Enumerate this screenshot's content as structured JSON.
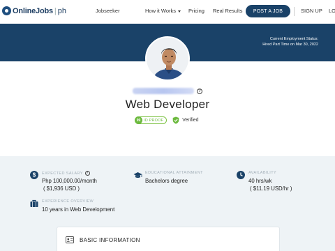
{
  "nav": {
    "logo_main": "OnlineJobs",
    "logo_sep": "|",
    "logo_suffix": "ph",
    "links": {
      "jobseeker": "Jobseeker",
      "how_it_works": "How it Works",
      "pricing": "Pricing",
      "real_results": "Real Results"
    },
    "post_job": "POST A JOB",
    "sign_up": "SIGN UP",
    "login_partial": "LO"
  },
  "banner": {
    "status_label": "Current Employment Status:",
    "status_value": "Hired Part Time on Mar 30, 2022"
  },
  "profile": {
    "title": "Web Developer",
    "id_score": "99",
    "id_label": "ID PROOF",
    "verified_label": "Verified"
  },
  "info": {
    "expected_salary": {
      "label": "EXPECTED SALARY",
      "value": "Php 100,000.00/month",
      "sub": "( $1,936 USD )"
    },
    "education": {
      "label": "EDUCATIONAL ATTAINMENT",
      "value": "Bachelors degree"
    },
    "availability": {
      "label": "AVAILABILITY",
      "value": "40 hrs/wk",
      "sub": "( $11.19 USD/hr )"
    },
    "experience": {
      "label": "EXPERIENCE OVERVIEW",
      "value": "10 years in Web Development"
    }
  },
  "card": {
    "title": "BASIC INFORMATION"
  },
  "colors": {
    "brand_navy": "#1a4268",
    "proof_green": "#6dba3f",
    "section_bg": "#eef3f6"
  }
}
